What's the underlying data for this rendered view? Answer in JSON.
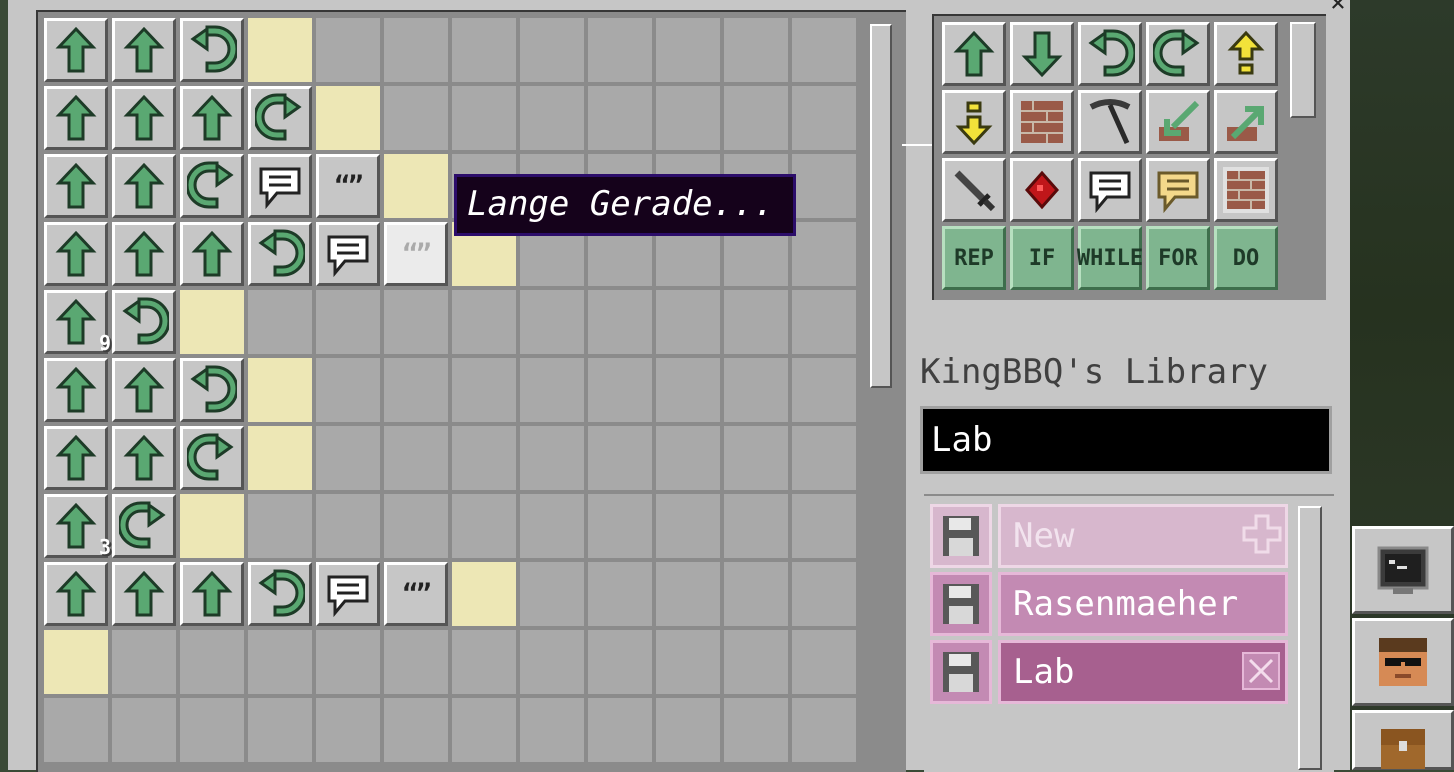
{
  "program_grid": {
    "columns": 12,
    "rows": [
      [
        "up",
        "up",
        "turn-left",
        "cursor",
        "empty",
        "empty",
        "empty",
        "empty",
        "empty",
        "empty",
        "empty",
        "empty"
      ],
      [
        "up",
        "up",
        "up",
        "turn-right",
        "cursor",
        "empty",
        "empty",
        "empty",
        "empty",
        "empty",
        "empty",
        "empty"
      ],
      [
        "up",
        "up",
        "turn-right",
        "say",
        "quote",
        "cursor",
        "empty",
        "empty",
        "empty",
        "empty",
        "empty",
        "empty"
      ],
      [
        "up",
        "up",
        "up",
        "turn-left",
        "say",
        "quote-sel",
        "cursor",
        "empty",
        "empty",
        "empty",
        "empty",
        "empty"
      ],
      [
        "up:9",
        "turn-left",
        "cursor",
        "empty",
        "empty",
        "empty",
        "empty",
        "empty",
        "empty",
        "empty",
        "empty",
        "empty"
      ],
      [
        "up",
        "up",
        "turn-left",
        "cursor",
        "empty",
        "empty",
        "empty",
        "empty",
        "empty",
        "empty",
        "empty",
        "empty"
      ],
      [
        "up",
        "up",
        "turn-right",
        "cursor",
        "empty",
        "empty",
        "empty",
        "empty",
        "empty",
        "empty",
        "empty",
        "empty"
      ],
      [
        "up:3",
        "turn-right",
        "cursor",
        "empty",
        "empty",
        "empty",
        "empty",
        "empty",
        "empty",
        "empty",
        "empty",
        "empty"
      ],
      [
        "up",
        "up",
        "up",
        "turn-left",
        "say",
        "quote",
        "cursor",
        "empty",
        "empty",
        "empty",
        "empty",
        "empty"
      ],
      [
        "cursor",
        "empty",
        "empty",
        "empty",
        "empty",
        "empty",
        "empty",
        "empty",
        "empty",
        "empty",
        "empty",
        "empty"
      ],
      [
        "empty",
        "empty",
        "empty",
        "empty",
        "empty",
        "empty",
        "empty",
        "empty",
        "empty",
        "empty",
        "empty",
        "empty"
      ]
    ]
  },
  "tooltip": {
    "text": "Lange Gerade..."
  },
  "palette": [
    {
      "icon": "up"
    },
    {
      "icon": "down"
    },
    {
      "icon": "turn-left"
    },
    {
      "icon": "turn-right"
    },
    {
      "icon": "up-yellow"
    },
    {
      "icon": "down-yellow"
    },
    {
      "icon": "brick"
    },
    {
      "icon": "pickaxe"
    },
    {
      "icon": "place-down"
    },
    {
      "icon": "place-up"
    },
    {
      "icon": "sword"
    },
    {
      "icon": "redstone"
    },
    {
      "icon": "say"
    },
    {
      "icon": "say-yellow"
    },
    {
      "icon": "brick-framed"
    },
    {
      "label": "REP"
    },
    {
      "label": "IF"
    },
    {
      "label": "WHILE"
    },
    {
      "label": "FOR"
    },
    {
      "label": "DO"
    }
  ],
  "library": {
    "title": "KingBBQ's Library",
    "search_value": "Lab",
    "items": [
      {
        "label": "New",
        "kind": "new"
      },
      {
        "label": "Rasenmaeher",
        "kind": "program"
      },
      {
        "label": "Lab",
        "kind": "program-active"
      }
    ]
  },
  "side_tabs": [
    "terminal-icon",
    "face-icon",
    "chest-icon"
  ],
  "colors": {
    "arrow": "#5aa872",
    "cursor_cell": "#ede7b5",
    "library_item": "#c38ab3",
    "tooltip_bg": "#15021b"
  }
}
